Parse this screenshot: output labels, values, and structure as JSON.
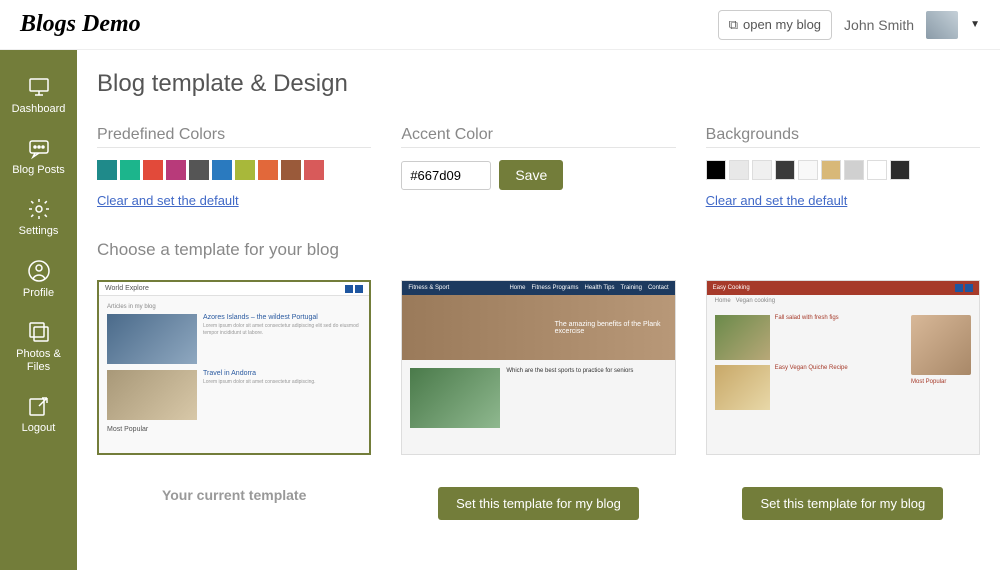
{
  "header": {
    "logo": "Blogs Demo",
    "open_blog_label": "open my blog",
    "user_name": "John Smith"
  },
  "sidebar": {
    "items": [
      {
        "label": "Dashboard"
      },
      {
        "label": "Blog Posts"
      },
      {
        "label": "Settings"
      },
      {
        "label": "Profile"
      },
      {
        "label": "Photos & Files"
      },
      {
        "label": "Logout"
      }
    ]
  },
  "page": {
    "title": "Blog template & Design",
    "predefined_colors": {
      "title": "Predefined Colors",
      "swatches": [
        "#1f8a8a",
        "#1cb58c",
        "#e24a3a",
        "#b83a7a",
        "#555555",
        "#2a7abf",
        "#a8b83a",
        "#e2683a",
        "#9a5a3a",
        "#d85a5a"
      ],
      "clear_label": "Clear and set the default"
    },
    "accent": {
      "title": "Accent Color",
      "value": "#667d09",
      "save_label": "Save"
    },
    "backgrounds": {
      "title": "Backgrounds",
      "swatches": [
        "#000000",
        "#e8e8e8",
        "#f0f0f0",
        "#3a3a3a",
        "#f8f8f8",
        "#d8b878",
        "#d0d0d0",
        "#ffffff",
        "#2a2a2a"
      ],
      "clear_label": "Clear and set the default"
    },
    "templates": {
      "title": "Choose a template for your blog",
      "current_label": "Your current template",
      "set_label": "Set this template for my blog",
      "cards": [
        {
          "name": "World Explore",
          "current": true
        },
        {
          "name": "Fitness & Sport",
          "current": false
        },
        {
          "name": "Easy Cooking",
          "current": false
        }
      ]
    }
  }
}
